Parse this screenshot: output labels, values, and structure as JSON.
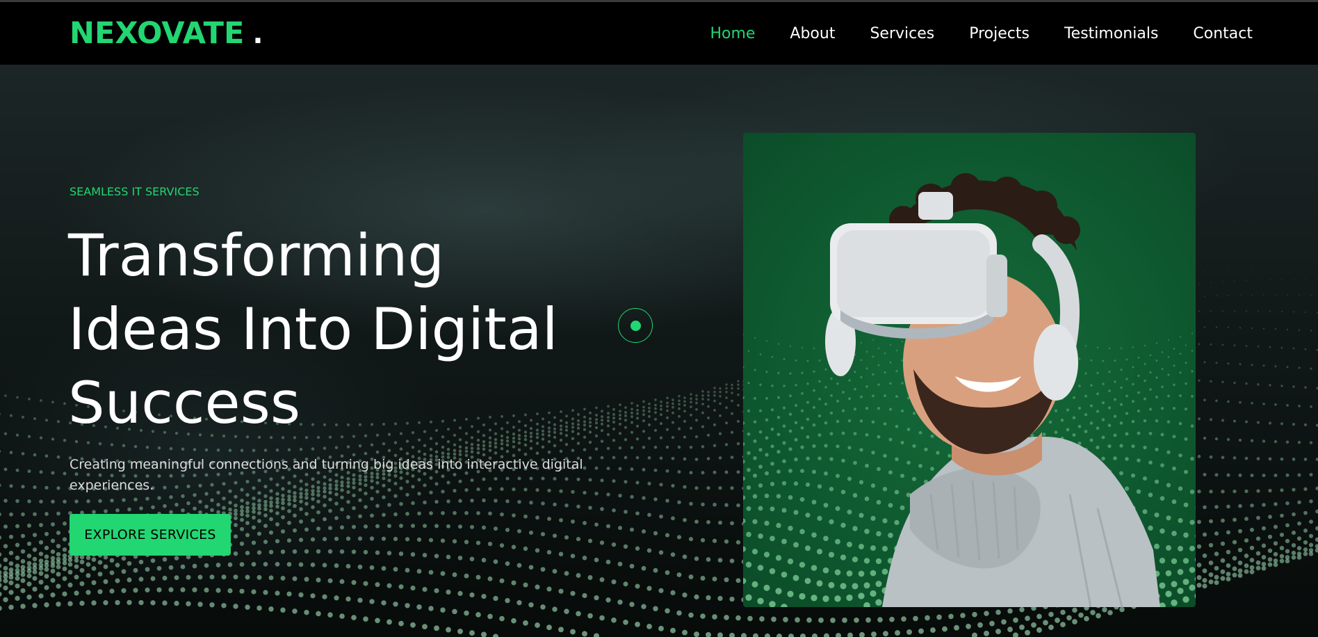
{
  "brand": {
    "name": "NEXOVATE",
    "dot": "."
  },
  "nav": {
    "items": [
      {
        "label": "Home",
        "active": true
      },
      {
        "label": "About",
        "active": false
      },
      {
        "label": "Services",
        "active": false
      },
      {
        "label": "Projects",
        "active": false
      },
      {
        "label": "Testimonials",
        "active": false
      },
      {
        "label": "Contact",
        "active": false
      }
    ]
  },
  "hero": {
    "eyebrow": "SEAMLESS IT SERVICES",
    "headline_lines": [
      "Transforming",
      "Ideas Into Digital",
      "Success"
    ],
    "subtext": "Creating meaningful connections and turning big ideas into interactive digital experiences.",
    "cta_label": "EXPLORE SERVICES",
    "play_icon": "play-circle-icon",
    "image_subject": "person-wearing-vr-headset"
  },
  "colors": {
    "accent": "#22d672",
    "nav_bg": "#000000",
    "hero_bg": "#111918",
    "card_bg": "#0f5a30",
    "text": "#ffffff"
  }
}
